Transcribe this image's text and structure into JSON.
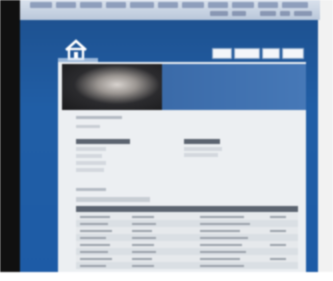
{
  "scene": {
    "description_kind": "blurred-photo-of-monitor",
    "colors": {
      "screen_blue": "#205ea6",
      "page_gray": "#eceff2",
      "header_dark": "#5c6470",
      "bezel": "#101010"
    },
    "icons": [
      "house-logo-icon"
    ]
  }
}
